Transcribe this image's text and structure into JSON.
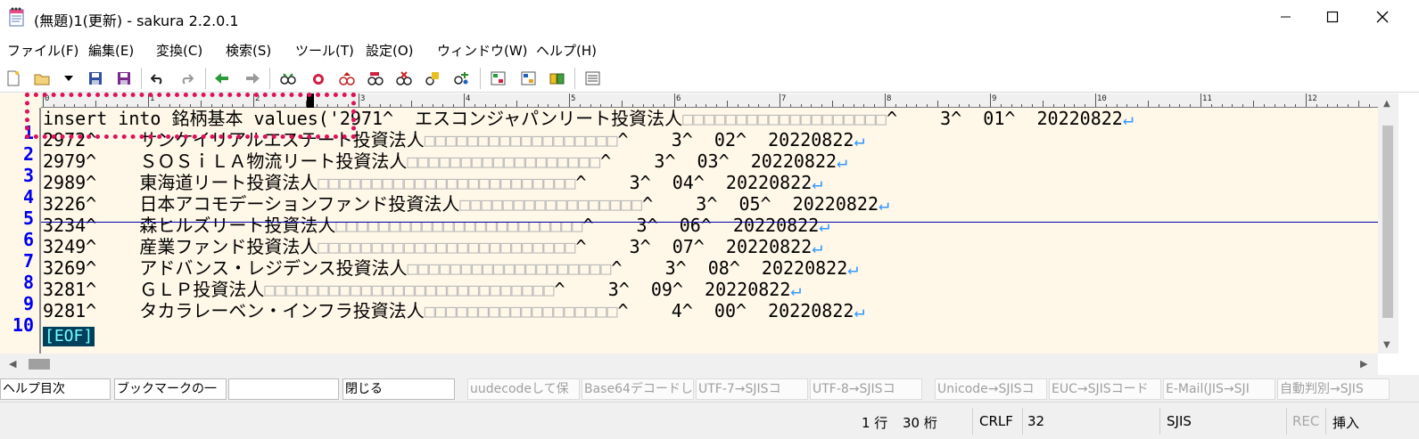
{
  "window": {
    "title": "(無題)1(更新) - sakura 2.2.0.1",
    "app_icon": "notepad-icon"
  },
  "menu": [
    "ファイル(F)",
    "編集(E)",
    "変換(C)",
    "検索(S)",
    "ツール(T)",
    "設定(O)",
    "ウィンドウ(W)",
    "ヘルプ(H)"
  ],
  "toolbar": {
    "icons": [
      "new-file-icon",
      "open-folder-icon",
      "dropdown-arrow-icon",
      "save-icon",
      "save-all-icon",
      "undo-icon",
      "redo-icon",
      "jump-back-icon",
      "jump-forward-icon",
      "search-icon",
      "search-next-icon",
      "search-prev-icon",
      "replace-icon",
      "clear-search-icon",
      "bookmark-icon",
      "grep-icon",
      "outline-icon",
      "compare-icon",
      "tag-jump-icon",
      "settings-icon"
    ]
  },
  "ruler": {
    "labels": [
      "0",
      "1",
      "2",
      "3",
      "4",
      "5",
      "6",
      "7",
      "8",
      "9",
      "10",
      "11",
      "12"
    ]
  },
  "editor": {
    "lines": [
      {
        "num": "1",
        "text": "insert into 銘柄基本 values('2971^  エスコンジャパンリート投資法人",
        "squares": "□□□□□□□□□□□□□□□□□□□",
        "tail": "^    3^  01^  20220822",
        "eol": "↵"
      },
      {
        "num": "2",
        "text": "2972^    サンケイリアルエステート投資法人",
        "squares": "□□□□□□□□□□□□□□□□□□",
        "tail": "^    3^  02^  20220822",
        "eol": "↵"
      },
      {
        "num": "3",
        "text": "2979^    ＳＯＳｉＬＡ物流リート投資法人",
        "squares": "□□□□□□□□□□□□□□□□□□",
        "tail": "^    3^  03^  20220822",
        "eol": "↵"
      },
      {
        "num": "4",
        "text": "2989^    東海道リート投資法人",
        "squares": "□□□□□□□□□□□□□□□□□□□□□□□□",
        "tail": "^    3^  04^  20220822",
        "eol": "↵"
      },
      {
        "num": "5",
        "text": "3226^    日本アコモデーションファンド投資法人",
        "squares": "□□□□□□□□□□□□□□□□□",
        "tail": "^    3^  05^  20220822",
        "eol": "↵"
      },
      {
        "num": "6",
        "text": "3234^    森ヒルズリート投資法人",
        "squares": "□□□□□□□□□□□□□□□□□□□□□□□",
        "tail": "^    3^  06^  20220822",
        "eol": "↵"
      },
      {
        "num": "7",
        "text": "3249^    産業ファンド投資法人",
        "squares": "□□□□□□□□□□□□□□□□□□□□□□□□",
        "tail": "^    3^  07^  20220822",
        "eol": "↵"
      },
      {
        "num": "8",
        "text": "3269^    アドバンス・レジデンス投資法人",
        "squares": "□□□□□□□□□□□□□□□□□□□",
        "tail": "^    3^  08^  20220822",
        "eol": "↵"
      },
      {
        "num": "9",
        "text": "3281^    ＧＬＰ投資法人",
        "squares": "□□□□□□□□□□□□□□□□□□□□□□□□□□□",
        "tail": "^    3^  09^  20220822",
        "eol": "↵"
      },
      {
        "num": "10",
        "text": "9281^    タカラレーベン・インフラ投資法人",
        "squares": "□□□□□□□□□□□□□□□□□□",
        "tail": "^    4^  00^  20220822",
        "eol": "↵"
      }
    ],
    "eof_marker": "[EOF]"
  },
  "function_keys": [
    {
      "label": "ヘルプ目次",
      "enabled": true
    },
    {
      "label": "ブックマークの一",
      "enabled": true
    },
    {
      "label": "",
      "enabled": true
    },
    {
      "label": "閉じる",
      "enabled": true
    },
    {
      "label": "uudecodeして保",
      "enabled": false
    },
    {
      "label": "Base64デコードし",
      "enabled": false
    },
    {
      "label": "UTF-7→SJISコ",
      "enabled": false
    },
    {
      "label": "UTF-8→SJISコ",
      "enabled": false
    },
    {
      "label": "Unicode→SJISコ",
      "enabled": false
    },
    {
      "label": "EUC→SJISコード",
      "enabled": false
    },
    {
      "label": "E-Mail(JIS→SJI",
      "enabled": false
    },
    {
      "label": "自動判別→SJIS",
      "enabled": false
    }
  ],
  "status": {
    "line": "1 行",
    "column": "30 桁",
    "line_ending": "CRLF",
    "char_code": "32",
    "encoding": "SJIS",
    "rec": "REC",
    "mode": "挿入"
  },
  "colors": {
    "editor_bg": "#fff7e8",
    "line_number": "#0000ee",
    "eol_mark": "#3399ff",
    "annotation": "#e0105a",
    "eof_bg": "#00405a"
  }
}
